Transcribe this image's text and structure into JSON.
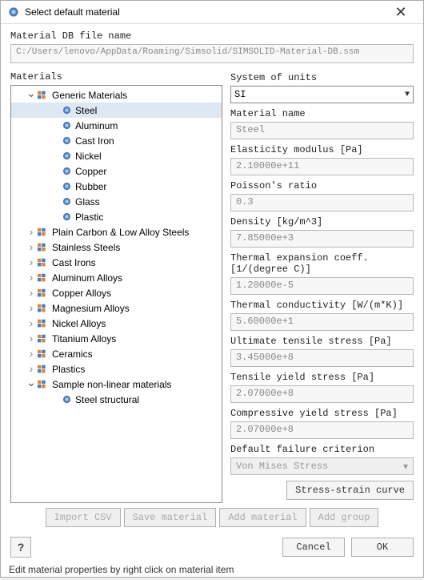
{
  "window": {
    "title": "Select default material"
  },
  "db": {
    "label": "Material DB file name",
    "path": "C:/Users/lenovo/AppData/Roaming/Simsolid/SIMSOLID-Material-DB.ssm"
  },
  "materialsLabel": "Materials",
  "tree": {
    "genericLabel": "Generic Materials",
    "genericItems": [
      "Steel",
      "Aluminum",
      "Cast Iron",
      "Nickel",
      "Copper",
      "Rubber",
      "Glass",
      "Plastic"
    ],
    "selected": "Steel",
    "categories": [
      "Plain Carbon & Low Alloy Steels",
      "Stainless Steels",
      "Cast Irons",
      "Aluminum Alloys",
      "Copper Alloys",
      "Magnesium Alloys",
      "Nickel Alloys",
      "Titanium Alloys",
      "Ceramics",
      "Plastics"
    ],
    "nonlinearLabel": "Sample non-linear materials",
    "nonlinearItems": [
      "Steel structural"
    ]
  },
  "units": {
    "label": "System of units",
    "value": "SI"
  },
  "props": {
    "name": {
      "label": "Material name",
      "value": "Steel"
    },
    "e": {
      "label": "Elasticity modulus [Pa]",
      "value": "2.10000e+11"
    },
    "nu": {
      "label": "Poisson's ratio",
      "value": "0.3"
    },
    "rho": {
      "label": "Density [kg/m^3]",
      "value": "7.85000e+3"
    },
    "alpha": {
      "label": "Thermal expansion coeff. [1/(degree C)]",
      "value": "1.20000e-5"
    },
    "k": {
      "label": "Thermal conductivity [W/(m*K)]",
      "value": "5.60000e+1"
    },
    "uts": {
      "label": "Ultimate tensile stress [Pa]",
      "value": "3.45000e+8"
    },
    "tys": {
      "label": "Tensile yield stress [Pa]",
      "value": "2.07000e+8"
    },
    "cys": {
      "label": "Compressive yield stress [Pa]",
      "value": "2.07000e+8"
    },
    "crit": {
      "label": "Default failure criterion",
      "value": "Von Mises Stress"
    }
  },
  "buttons": {
    "stressCurve": "Stress-strain curve",
    "importCsv": "Import CSV",
    "saveMaterial": "Save material",
    "addMaterial": "Add material",
    "addGroup": "Add group",
    "cancel": "Cancel",
    "ok": "OK",
    "help": "?"
  },
  "hint": "Edit material properties by right click on material item",
  "colors": {
    "iconBlue": "#4a7bbd",
    "iconOrange": "#d8863c"
  }
}
